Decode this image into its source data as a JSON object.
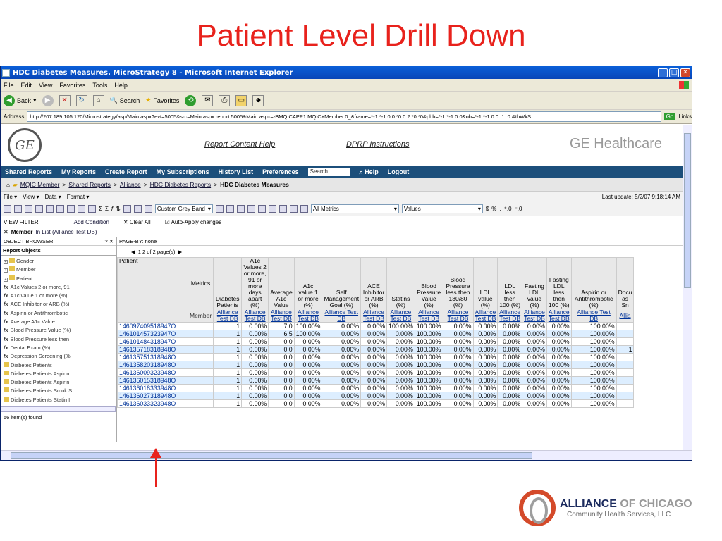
{
  "slide": {
    "title": "Patient Level Drill Down"
  },
  "window": {
    "title": "HDC Diabetes Measures. MicroStrategy 8 - Microsoft Internet Explorer"
  },
  "menu": [
    "File",
    "Edit",
    "View",
    "Favorites",
    "Tools",
    "Help"
  ],
  "toolbar": {
    "back": "Back",
    "search": "Search",
    "favorites": "Favorites"
  },
  "address": {
    "label": "Address",
    "url": "http://207.189.105.120/Microstrategy/asp/Main.aspx?evt=5005&src=Main.aspx.report.5005&Main.aspx=-BMQICAPP1.MQIC+Member.0_&frame=*-1.*-1.0.0.*0.0.2.*0.*0&pbb=*-1.*-1.0.0&ob=*-1.*-1.0.0..1..0.&tbWkS",
    "go": "Go",
    "links": "Links"
  },
  "header": {
    "report_help": "Report Content Help",
    "dprp": "DPRP Instructions",
    "brand": "GE Healthcare",
    "logo": "GE"
  },
  "nav": [
    "Shared Reports",
    "My Reports",
    "Create Report",
    "My Subscriptions",
    "History List",
    "Preferences"
  ],
  "nav_search": "Search",
  "nav_help": "Help",
  "nav_logout": "Logout",
  "breadcrumb": {
    "items": [
      "MQIC Member",
      "Shared Reports",
      "Alliance",
      "HDC Diabetes Reports"
    ],
    "current": "HDC Diabetes Measures"
  },
  "report_menu": [
    "File",
    "View",
    "Data",
    "Format"
  ],
  "last_update": "Last update: 5/2/07 9:18:14 AM",
  "iconbar": {
    "band": "Custom Grey Band",
    "metrics": "All Metrics",
    "values": "Values"
  },
  "view_filter": {
    "label": "VIEW FILTER",
    "add": "Add Condition",
    "clear": "Clear All",
    "auto": "Auto-Apply changes",
    "member_label": "Member",
    "member_value": "In List (Alliance Test DB)"
  },
  "object_browser": {
    "title": "OBJECT BROWSER",
    "tab": "Report Objects",
    "items": [
      {
        "kind": "folder",
        "label": "Gender"
      },
      {
        "kind": "folder",
        "label": "Member"
      },
      {
        "kind": "folder",
        "label": "Patient"
      },
      {
        "kind": "fx",
        "label": "A1c Values 2 or more, 91"
      },
      {
        "kind": "fx",
        "label": "A1c value 1 or more (%)"
      },
      {
        "kind": "fx",
        "label": "ACE Inhibitor or ARB (%)"
      },
      {
        "kind": "fx",
        "label": "Aspirin or Antithrombotic"
      },
      {
        "kind": "fx",
        "label": "Average A1c Value"
      },
      {
        "kind": "fx",
        "label": "Blood Pressure Value (%)"
      },
      {
        "kind": "fx",
        "label": "Blood Pressure less then"
      },
      {
        "kind": "fx",
        "label": "Dental Exam (%)"
      },
      {
        "kind": "fx",
        "label": "Depression Screening (%"
      },
      {
        "kind": "doc",
        "label": "Diabetes Patients"
      },
      {
        "kind": "doc",
        "label": "Diabetes Patients Aspirin"
      },
      {
        "kind": "doc",
        "label": "Diabetes Patients Aspirin"
      },
      {
        "kind": "doc",
        "label": "Diabetes Patients Smok S"
      },
      {
        "kind": "doc",
        "label": "Diabetes Patients Statin I"
      },
      {
        "kind": "doc",
        "label": "Diabetes Patients Statin r"
      }
    ],
    "found": "56 item(s) found"
  },
  "grid": {
    "page_by": "PAGE-BY: none",
    "pager": "1  2  of 2 page(s)",
    "patient_header": "Patient",
    "metrics_label": "Metrics",
    "member_label": "Member",
    "columns": [
      "Diabetes Patients",
      "A1c Values 2 or more, 91 or more days apart (%)",
      "Average A1c Value",
      "A1c value 1 or more (%)",
      "Self Management Goal (%)",
      "ACE Inhibitor or ARB (%)",
      "Statins (%)",
      "Blood Pressure Value (%)",
      "Blood Pressure less then 130/80 (%)",
      "LDL value (%)",
      "LDL less then 100 (%)",
      "Fasting LDL value (%)",
      "Fasting LDL less then 100 (%)",
      "Aspirin or Antithrombotic (%)",
      "Docu as Sn"
    ],
    "member_values": [
      "Alliance Test DB",
      "Alliance Test DB",
      "Alliance Test DB",
      "Alliance Test DB",
      "Alliance Test DB",
      "Alliance Test DB",
      "Alliance Test DB",
      "Alliance Test DB",
      "Alliance Test DB",
      "Alliance Test DB",
      "Alliance Test DB",
      "Alliance Test DB",
      "Alliance Test DB",
      "Alliance Test DB",
      "Allia"
    ],
    "rows": [
      {
        "id": "146097409518947O",
        "v": [
          "1",
          "0.00%",
          "7.0",
          "100.00%",
          "0.00%",
          "0.00%",
          "100.00%",
          "100.00%",
          "0.00%",
          "0.00%",
          "0.00%",
          "0.00%",
          "0.00%",
          "100.00%",
          ""
        ]
      },
      {
        "id": "146101457323947O",
        "v": [
          "1",
          "0.00%",
          "6.5",
          "100.00%",
          "0.00%",
          "0.00%",
          "0.00%",
          "100.00%",
          "0.00%",
          "0.00%",
          "0.00%",
          "0.00%",
          "0.00%",
          "100.00%",
          ""
        ]
      },
      {
        "id": "146101484318947O",
        "v": [
          "1",
          "0.00%",
          "0.0",
          "0.00%",
          "0.00%",
          "0.00%",
          "0.00%",
          "100.00%",
          "0.00%",
          "0.00%",
          "0.00%",
          "0.00%",
          "0.00%",
          "100.00%",
          ""
        ]
      },
      {
        "id": "146135718318948O",
        "v": [
          "1",
          "0.00%",
          "0.0",
          "0.00%",
          "0.00%",
          "0.00%",
          "0.00%",
          "100.00%",
          "0.00%",
          "0.00%",
          "0.00%",
          "0.00%",
          "0.00%",
          "100.00%",
          "1"
        ]
      },
      {
        "id": "146135751318948O",
        "v": [
          "1",
          "0.00%",
          "0.0",
          "0.00%",
          "0.00%",
          "0.00%",
          "0.00%",
          "100.00%",
          "0.00%",
          "0.00%",
          "0.00%",
          "0.00%",
          "0.00%",
          "100.00%",
          ""
        ]
      },
      {
        "id": "146135820318948O",
        "v": [
          "1",
          "0.00%",
          "0.0",
          "0.00%",
          "0.00%",
          "0.00%",
          "0.00%",
          "100.00%",
          "0.00%",
          "0.00%",
          "0.00%",
          "0.00%",
          "0.00%",
          "100.00%",
          ""
        ]
      },
      {
        "id": "146136009323948O",
        "v": [
          "1",
          "0.00%",
          "0.0",
          "0.00%",
          "0.00%",
          "0.00%",
          "0.00%",
          "100.00%",
          "0.00%",
          "0.00%",
          "0.00%",
          "0.00%",
          "0.00%",
          "100.00%",
          ""
        ]
      },
      {
        "id": "146136015318948O",
        "v": [
          "1",
          "0.00%",
          "0.0",
          "0.00%",
          "0.00%",
          "0.00%",
          "0.00%",
          "100.00%",
          "0.00%",
          "0.00%",
          "0.00%",
          "0.00%",
          "0.00%",
          "100.00%",
          ""
        ]
      },
      {
        "id": "146136018333948O",
        "v": [
          "1",
          "0.00%",
          "0.0",
          "0.00%",
          "0.00%",
          "0.00%",
          "0.00%",
          "100.00%",
          "0.00%",
          "0.00%",
          "0.00%",
          "0.00%",
          "0.00%",
          "100.00%",
          ""
        ]
      },
      {
        "id": "146136027318948O",
        "v": [
          "1",
          "0.00%",
          "0.0",
          "0.00%",
          "0.00%",
          "0.00%",
          "0.00%",
          "100.00%",
          "0.00%",
          "0.00%",
          "0.00%",
          "0.00%",
          "0.00%",
          "100.00%",
          ""
        ]
      },
      {
        "id": "146136033323948O",
        "v": [
          "1",
          "0.00%",
          "0.0",
          "0.00%",
          "0.00%",
          "0.00%",
          "0.00%",
          "100.00%",
          "0.00%",
          "0.00%",
          "0.00%",
          "0.00%",
          "0.00%",
          "100.00%",
          ""
        ]
      }
    ]
  },
  "footer_logo": {
    "line1a": "ALLIANCE",
    "line1b": "OF CHICAGO",
    "line2": "Community Health Services, LLC"
  }
}
